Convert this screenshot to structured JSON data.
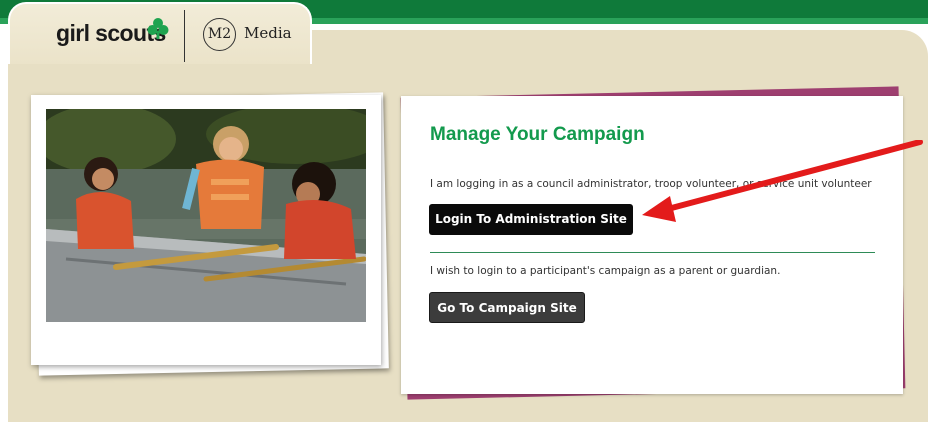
{
  "header": {
    "logo_text": "girl scouts",
    "partner_logo_mark": "M2",
    "partner_logo_text": "Media"
  },
  "photo": {
    "subject": "three girls in life jackets leaning over a canoe"
  },
  "campaign_card": {
    "title": "Manage Your Campaign",
    "admin_prompt": "I am logging in as a council administrator, troop volunteer, or service unit volunteer",
    "admin_button": "Login To Administration Site",
    "participant_prompt": "I wish to login to a participant's campaign as a parent or guardian.",
    "campaign_button": "Go To Campaign Site"
  },
  "colors": {
    "brand_green": "#139a4d",
    "header_green": "#0f7a3a",
    "page_beige": "#e7dfc4",
    "card_accent": "#9e3f70",
    "annotation_arrow": "#e31b1b"
  },
  "icons": {
    "trefoil": "trefoil-icon",
    "arrow": "red-annotation-arrow"
  }
}
